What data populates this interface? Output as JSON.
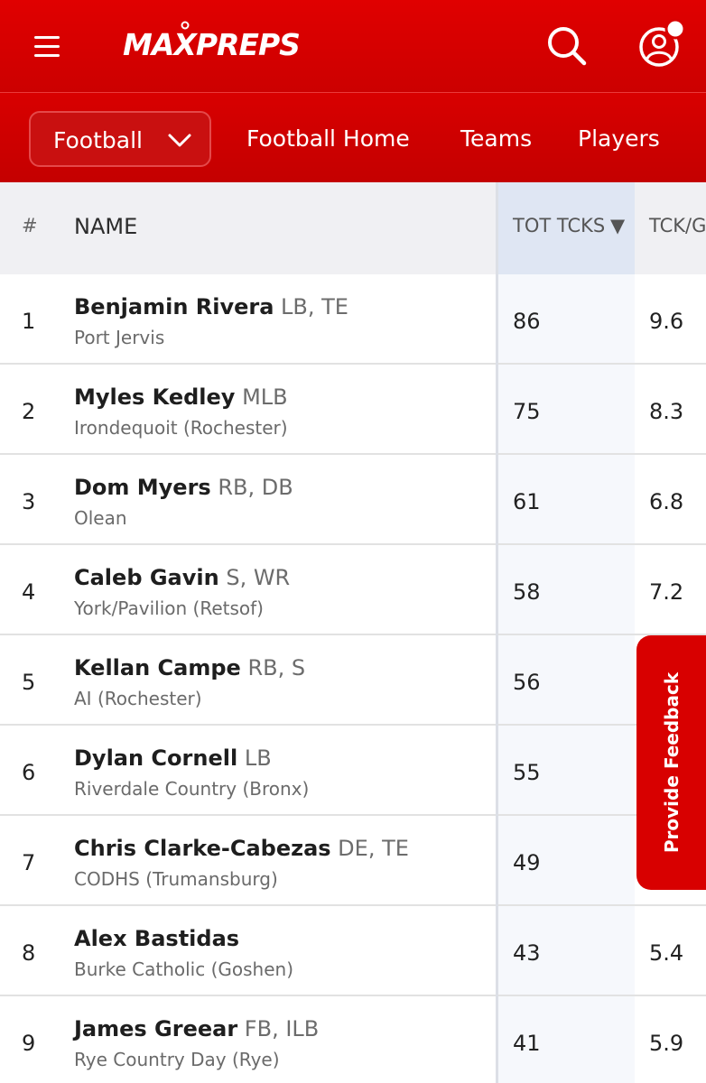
{
  "header": {
    "logo_text": "MAXPREPS",
    "brand_color": "#d80000",
    "menu_icon": "hamburger-menu-icon",
    "search_icon": "search-icon",
    "account_icon": "user-account-icon"
  },
  "subnav": {
    "sport_select": "Football",
    "links": [
      "Football Home",
      "Teams",
      "Players"
    ]
  },
  "table": {
    "columns": {
      "rank": "#",
      "name": "NAME",
      "tot_tcks": "TOT TCKS",
      "tck_g": "TCK/G"
    },
    "sort_indicator": "▼",
    "rows": [
      {
        "rank": "1",
        "name": "Benjamin Rivera",
        "pos": "LB, TE",
        "school": "Port Jervis",
        "tot": "86",
        "tckg": "9.6"
      },
      {
        "rank": "2",
        "name": "Myles Kedley",
        "pos": "MLB",
        "school": "Irondequoit (Rochester)",
        "tot": "75",
        "tckg": "8.3"
      },
      {
        "rank": "3",
        "name": "Dom Myers",
        "pos": "RB, DB",
        "school": "Olean",
        "tot": "61",
        "tckg": "6.8"
      },
      {
        "rank": "4",
        "name": "Caleb Gavin",
        "pos": "S, WR",
        "school": "York/Pavilion (Retsof)",
        "tot": "58",
        "tckg": "7.2"
      },
      {
        "rank": "5",
        "name": "Kellan Campe",
        "pos": "RB, S",
        "school": "AI (Rochester)",
        "tot": "56",
        "tckg": ""
      },
      {
        "rank": "6",
        "name": "Dylan Cornell",
        "pos": "LB",
        "school": "Riverdale Country (Bronx)",
        "tot": "55",
        "tckg": ""
      },
      {
        "rank": "7",
        "name": "Chris Clarke-Cabezas",
        "pos": "DE, TE",
        "school": "CODHS (Trumansburg)",
        "tot": "49",
        "tckg": ""
      },
      {
        "rank": "8",
        "name": "Alex Bastidas",
        "pos": "",
        "school": "Burke Catholic (Goshen)",
        "tot": "43",
        "tckg": "5.4"
      },
      {
        "rank": "9",
        "name": "James Greear",
        "pos": "FB, ILB",
        "school": "Rye Country Day (Rye)",
        "tot": "41",
        "tckg": "5.9"
      }
    ]
  },
  "feedback": {
    "label": "Provide Feedback"
  }
}
